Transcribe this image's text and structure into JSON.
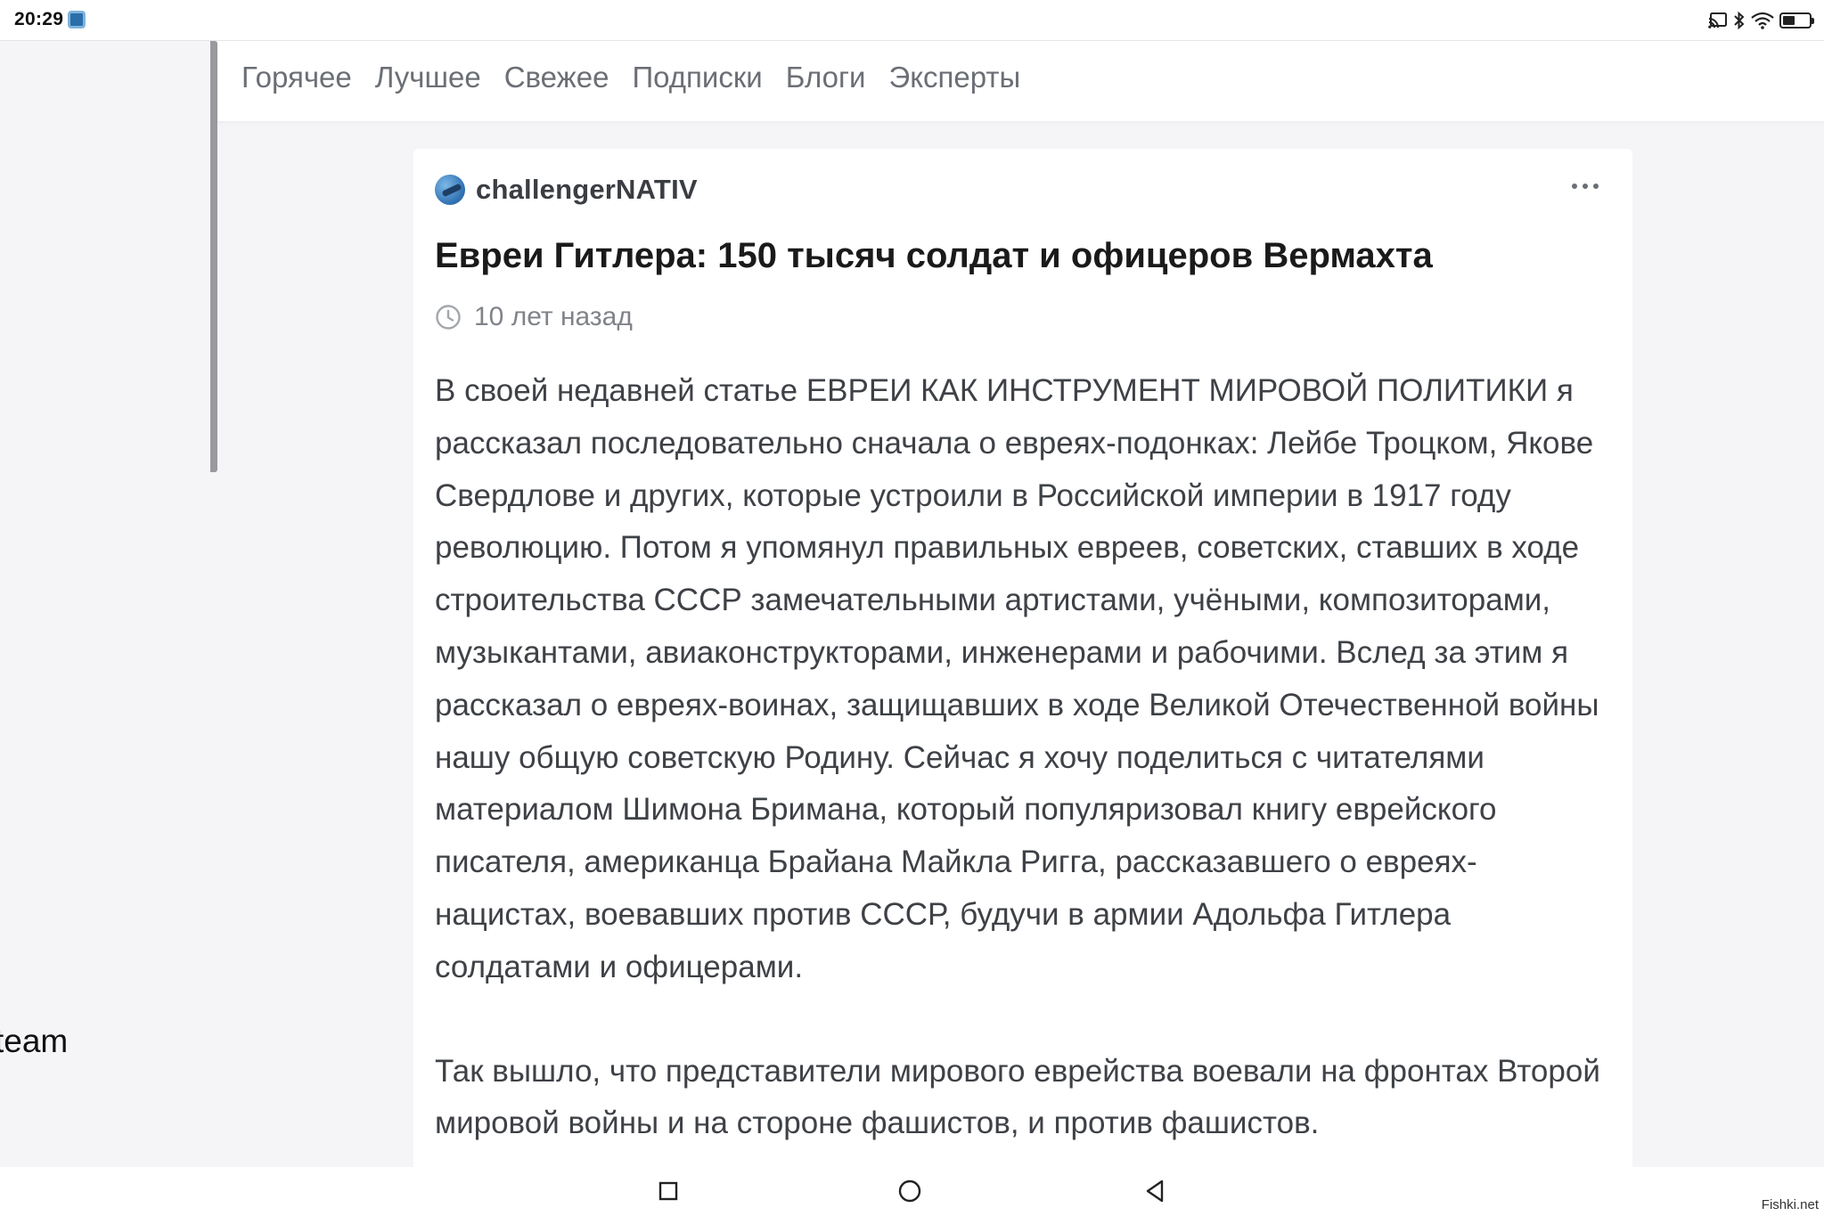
{
  "status_bar": {
    "time": "20:29"
  },
  "nav": {
    "tabs": [
      {
        "label": "Горячее"
      },
      {
        "label": "Лучшее"
      },
      {
        "label": "Свежее"
      },
      {
        "label": "Подписки"
      },
      {
        "label": "Блоги"
      },
      {
        "label": "Эксперты"
      }
    ]
  },
  "sidebar": {
    "cut_text": "team"
  },
  "article": {
    "author": "challengerNATIV",
    "title": "Евреи Гитлера: 150 тысяч солдат и офицеров Вермахта",
    "time_ago": "10 лет назад",
    "paragraphs": [
      "В своей недавней статье ЕВРЕИ КАК ИНСТРУМЕНТ МИРОВОЙ ПОЛИТИКИ я рассказал последовательно сначала о евреях-подонках: Лейбе Троцком, Якове Свердлове и других, которые устроили в Российской империи в 1917 году революцию. Потом я упомянул правильных евреев, советских, ставших в ходе строительства СССР замечательными артистами, учёными, композиторами, музыкантами, авиаконструкторами, инженерами и рабочими. Вслед за этим я рассказал о евреях-воинах, защищавших в ходе Великой Отечественной войны нашу общую советскую Родину. Сейчас я хочу поделиться с читателями материалом Шимона Бримана, который популяризовал книгу еврейского писателя, американца Брайана Майкла Ригга, рассказавшего о евреях-нацистах, воевавших против СССР, будучи в армии Адольфа Гитлера солдатами и офицерами.",
      "Так вышло, что представители мирового еврейства воевали на фронтах Второй мировой войны и на стороне фашистов, и против фашистов."
    ]
  },
  "battery_level": 0.45,
  "watermark": "Fishki.net"
}
